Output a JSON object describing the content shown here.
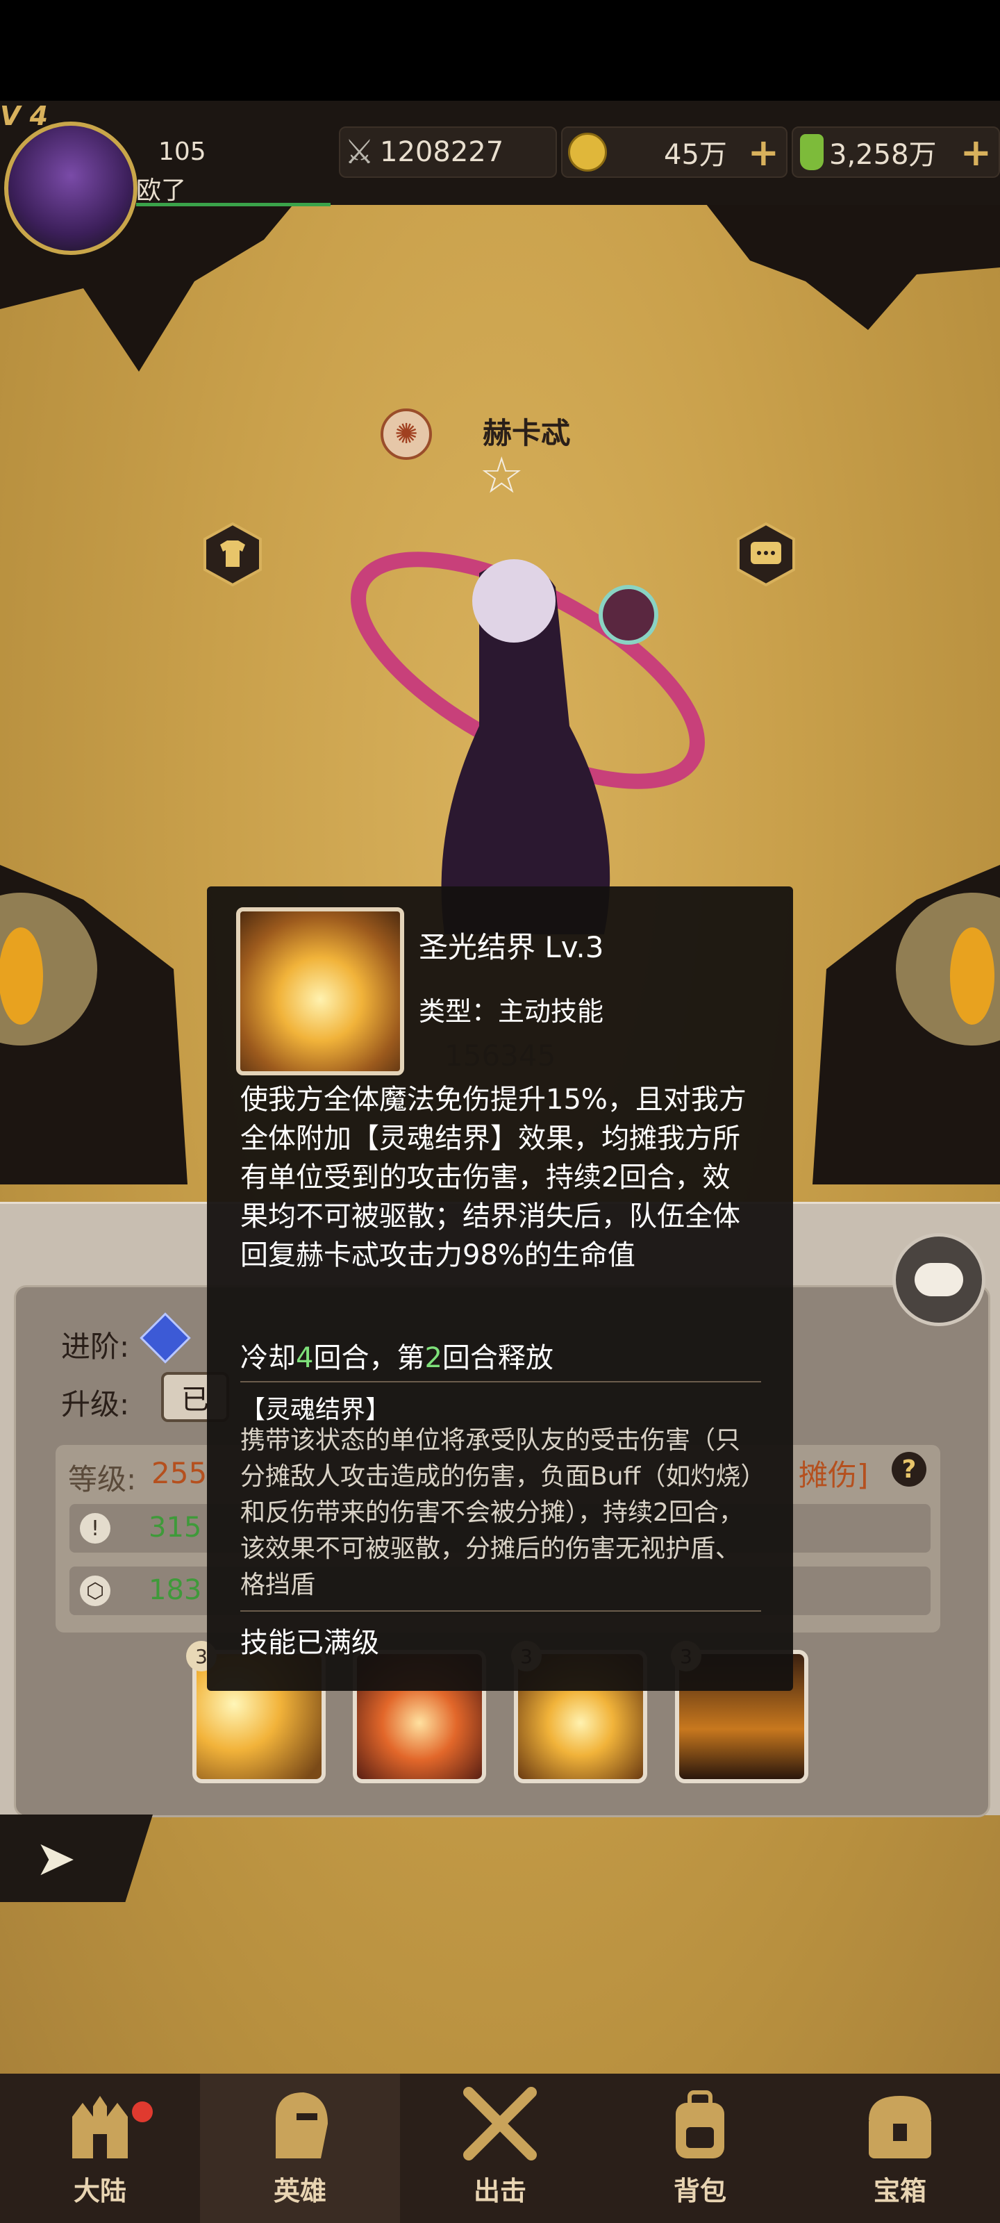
{
  "player": {
    "level_badge": "V 4",
    "score": "105",
    "name": "欧了"
  },
  "currencies": {
    "power": "1208227",
    "gold": "45万",
    "potion": "3,258万"
  },
  "hero": {
    "name": "赫卡忒",
    "power": "156345"
  },
  "skill": {
    "name": "圣光结界 Lv.3",
    "type": "类型：主动技能",
    "description": "使我方全体魔法免伤提升15%，且对我方全体附加【灵魂结界】效果，均摊我方所有单位受到的攻击伤害，持续2回合，效果均不可被驱散；结界消失后，队伍全体回复赫卡忒攻击力98%的生命值",
    "cooldown_prefix": "冷却",
    "cooldown_value": "4",
    "cooldown_mid": "回合，第",
    "release_round": "2",
    "cooldown_suffix": "回合释放",
    "status_title": "【灵魂结界】",
    "status_desc": "携带该状态的单位将承受队友的受击伤害（只分摊敌人攻击造成的伤害，负面Buff（如灼烧）和反伤带来的伤害不会被分摊），持续2回合，该效果不可被驱散，分摊后的伤害无视护盾、格挡盾",
    "maxed": "技能已满级"
  },
  "panel": {
    "advance_label": "进阶:",
    "upgrade_label": "升级:",
    "upgrade_btn": "已",
    "level_label": "等级:",
    "level_value": "255",
    "stat1": "315",
    "stat2": "183",
    "tag": "摊伤]",
    "help": "?",
    "slots": [
      "3",
      "3",
      "3",
      "3"
    ]
  },
  "nav": [
    "大陆",
    "英雄",
    "出击",
    "背包",
    "宝箱"
  ],
  "colors": {
    "accent_green": "#7ee07a",
    "gold": "#d8b15c",
    "badge_red": "#e03a2f"
  }
}
